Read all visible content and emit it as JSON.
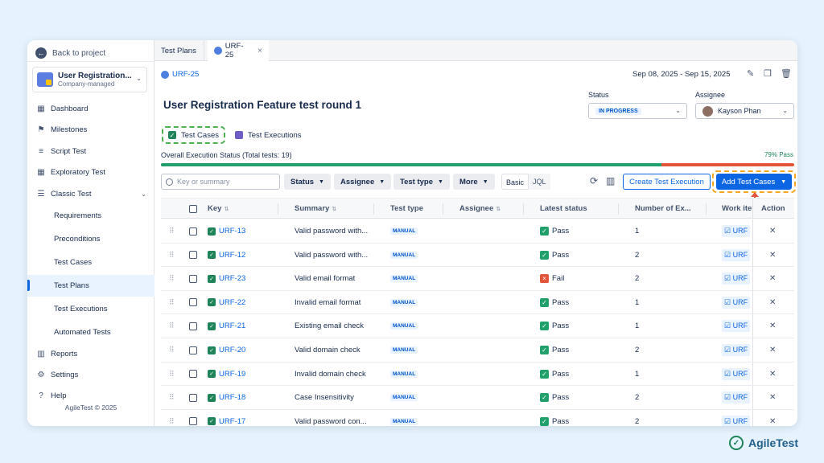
{
  "sidebar": {
    "back_label": "Back to project",
    "project_name": "User Registration...",
    "project_type": "Company-managed",
    "items": [
      {
        "label": "Dashboard",
        "icon": "dashboard-icon"
      },
      {
        "label": "Milestones",
        "icon": "flag-icon"
      },
      {
        "label": "Script Test",
        "icon": "script-icon"
      },
      {
        "label": "Exploratory Test",
        "icon": "grid-icon"
      },
      {
        "label": "Classic Test",
        "icon": "list-icon"
      },
      {
        "label": "Requirements"
      },
      {
        "label": "Preconditions"
      },
      {
        "label": "Test Cases"
      },
      {
        "label": "Test Plans",
        "active": true
      },
      {
        "label": "Test Executions"
      },
      {
        "label": "Automated Tests"
      },
      {
        "label": "Reports",
        "icon": "chart-icon"
      },
      {
        "label": "Settings",
        "icon": "gear-icon"
      },
      {
        "label": "Help",
        "icon": "help-icon"
      }
    ],
    "copyright": "AgileTest © 2025"
  },
  "tabs": {
    "first": "Test Plans",
    "second": "URF-25"
  },
  "header": {
    "breadcrumb": "URF-25",
    "date_range": "Sep 08, 2025 - Sep 15, 2025",
    "title": "User Registration Feature test round 1",
    "status_label": "Status",
    "status_value": "IN PROGRESS",
    "assignee_label": "Assignee",
    "assignee_value": "Kayson Phan"
  },
  "subtabs": {
    "test_cases": "Test Cases",
    "test_executions": "Test Executions"
  },
  "progress": {
    "label": "Overall Execution Status (Total tests: 19)",
    "pass_label": "79% Pass",
    "pass_fraction": 0.79
  },
  "toolbar": {
    "search_placeholder": "Key or summary",
    "status": "Status",
    "assignee": "Assignee",
    "test_type": "Test type",
    "more": "More",
    "basic": "Basic",
    "jql": "JQL",
    "create_exec": "Create Test Execution",
    "add_cases": "Add Test Cases"
  },
  "table": {
    "headers": {
      "key": "Key",
      "summary": "Summary",
      "type": "Test type",
      "assignee": "Assignee",
      "status": "Latest status",
      "number": "Number of Ex...",
      "work": "Work ite",
      "action": "Action"
    },
    "rows": [
      {
        "key": "URF-13",
        "summary": "Valid password with...",
        "type": "MANUAL",
        "status": "Pass",
        "number": "1",
        "work": "URF"
      },
      {
        "key": "URF-12",
        "summary": "Valid password with...",
        "type": "MANUAL",
        "status": "Pass",
        "number": "2",
        "work": "URF"
      },
      {
        "key": "URF-23",
        "summary": "Valid email format",
        "type": "MANUAL",
        "status": "Fail",
        "number": "2",
        "work": "URF"
      },
      {
        "key": "URF-22",
        "summary": "Invalid email format",
        "type": "MANUAL",
        "status": "Pass",
        "number": "1",
        "work": "URF"
      },
      {
        "key": "URF-21",
        "summary": "Existing email check",
        "type": "MANUAL",
        "status": "Pass",
        "number": "1",
        "work": "URF"
      },
      {
        "key": "URF-20",
        "summary": "Valid domain check",
        "type": "MANUAL",
        "status": "Pass",
        "number": "2",
        "work": "URF"
      },
      {
        "key": "URF-19",
        "summary": "Invalid domain check",
        "type": "MANUAL",
        "status": "Pass",
        "number": "1",
        "work": "URF"
      },
      {
        "key": "URF-18",
        "summary": "Case Insensitivity",
        "type": "MANUAL",
        "status": "Pass",
        "number": "2",
        "work": "URF"
      },
      {
        "key": "URF-17",
        "summary": "Valid password con...",
        "type": "MANUAL",
        "status": "Pass",
        "number": "2",
        "work": "URF"
      }
    ]
  },
  "brand": {
    "name": "AgileTest"
  },
  "colors": {
    "accent": "#0c66e4",
    "pass": "#22a06b",
    "fail": "#e2553a",
    "highlight": "#f5a623"
  }
}
